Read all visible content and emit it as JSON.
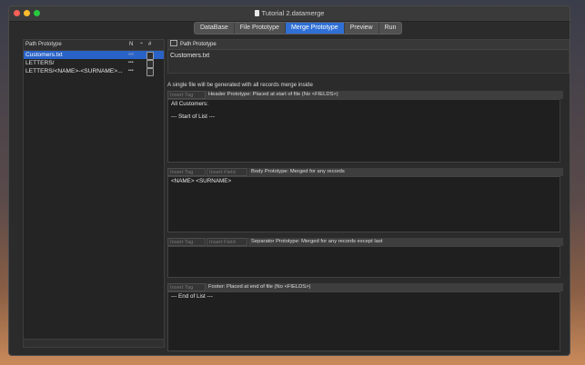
{
  "window": {
    "title": "Tutorial 2.datamerge",
    "traffic_lights": {
      "close": "#ff5f57",
      "minimize": "#febc2e",
      "zoom": "#28c840"
    }
  },
  "tabs": [
    {
      "label": "DataBase"
    },
    {
      "label": "File Prototype"
    },
    {
      "label": "Merge Prototype",
      "active": true
    },
    {
      "label": "Preview"
    },
    {
      "label": "Run"
    }
  ],
  "sidebar": {
    "header": {
      "path_label": "Path Prototype",
      "n_label": "N",
      "sort_label": "⌃",
      "hash_label": "#"
    },
    "rows": [
      {
        "name": "Customers.txt",
        "n": "»«",
        "selected": true
      },
      {
        "name": "LETTERS/",
        "n": "▪▪▪"
      },
      {
        "name": "LETTERS/<NAME>-<SURNAME>...",
        "n": "▪▪▪"
      }
    ]
  },
  "path_prototype": {
    "label": "Path Prototype",
    "value": "Customers.txt"
  },
  "note": "A single file will be generated with all records merge inside",
  "sections": {
    "header": {
      "insert_tag": "Insert Tag",
      "label": "Header Prototype: Placed at start of file (No <FIELDS>)",
      "text": "All Customers:\n\n--- Start of List ---"
    },
    "body": {
      "insert_tag": "Insert Tag",
      "insert_field": "Insert Field",
      "label": "Body Prototype: Merged for any records",
      "text": "<NAME> <SURNAME>"
    },
    "separator": {
      "insert_tag": "Insert Tag",
      "insert_field": "Insert Field",
      "label": "Separator Prototype: Merged for any records except last",
      "text": ""
    },
    "footer": {
      "insert_tag": "Insert Tag",
      "label": "Footer: Placed at end of file (No <FIELDS>)",
      "text": "--- End of List ---"
    }
  }
}
